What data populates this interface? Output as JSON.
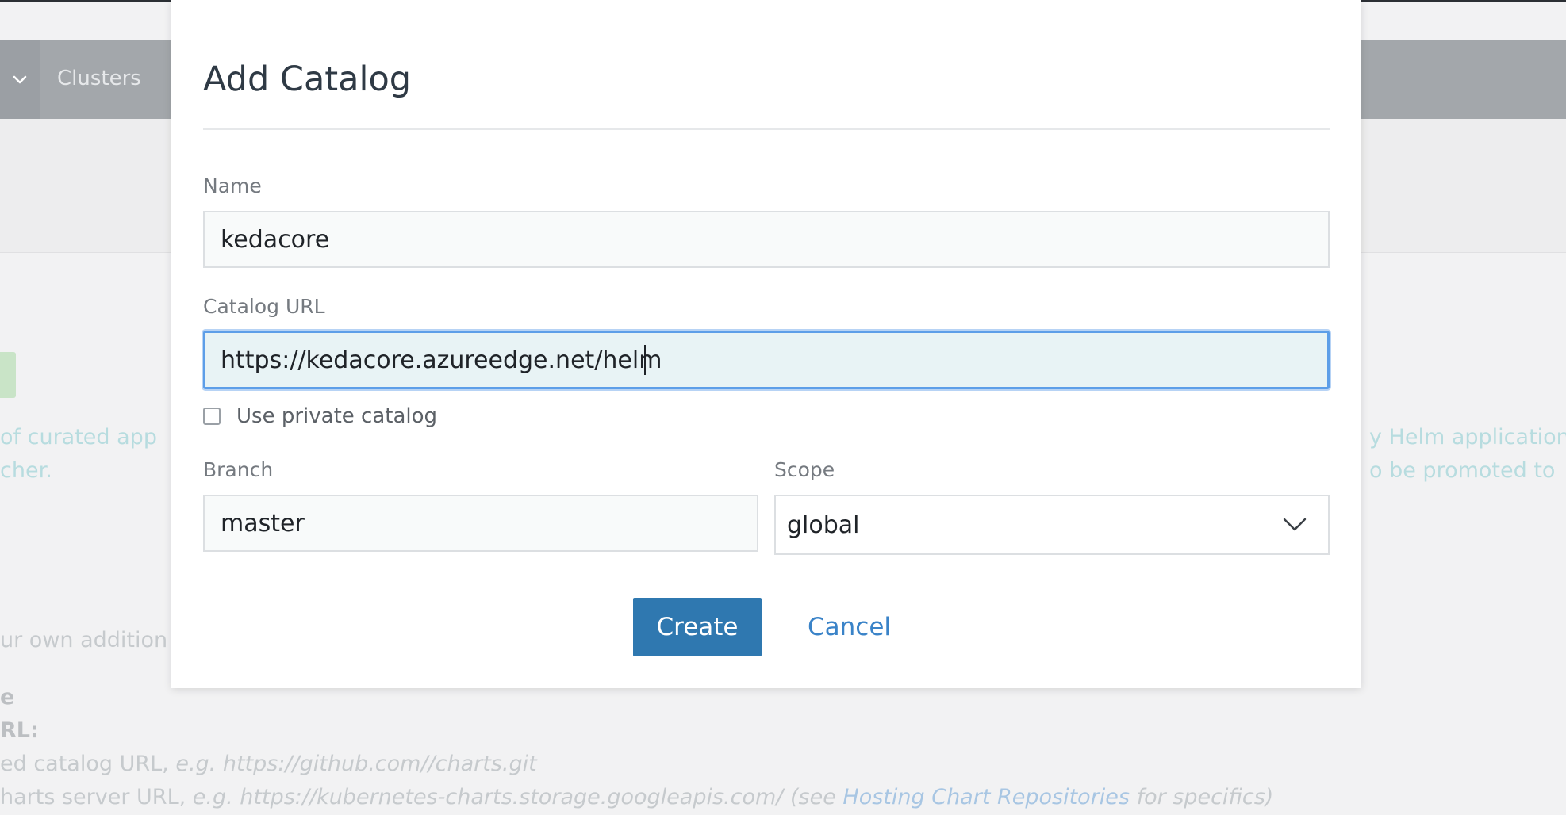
{
  "background": {
    "header": {
      "nav_label": "Clusters"
    },
    "lines": {
      "curated_left": "of curated app",
      "cher": "cher.",
      "helm_right": "y Helm application",
      "promoted_right": "o be promoted to",
      "own_addition": "ur own addition",
      "e_fragment": "e",
      "url_label": "RL:",
      "git_prefix": "ed catalog URL, ",
      "git_eg": "e.g. https://github.com//charts.git",
      "charts_prefix": "harts server URL, ",
      "charts_eg": "e.g. https://kubernetes-charts.storage.googleapis.com/ (see ",
      "charts_link": "Hosting Chart Repositories",
      "charts_suffix": " for specifics)"
    }
  },
  "modal": {
    "title": "Add Catalog",
    "name": {
      "label": "Name",
      "value": "kedacore"
    },
    "url": {
      "label": "Catalog URL",
      "value": "https://kedacore.azureedge.net/helm"
    },
    "private": {
      "label": "Use private catalog",
      "checked": false
    },
    "branch": {
      "label": "Branch",
      "value": "master"
    },
    "scope": {
      "label": "Scope",
      "value": "global"
    },
    "actions": {
      "create": "Create",
      "cancel": "Cancel"
    }
  },
  "colors": {
    "primary": "#2f78b0",
    "link": "#3a83c8",
    "focus": "#5d9ee8"
  }
}
